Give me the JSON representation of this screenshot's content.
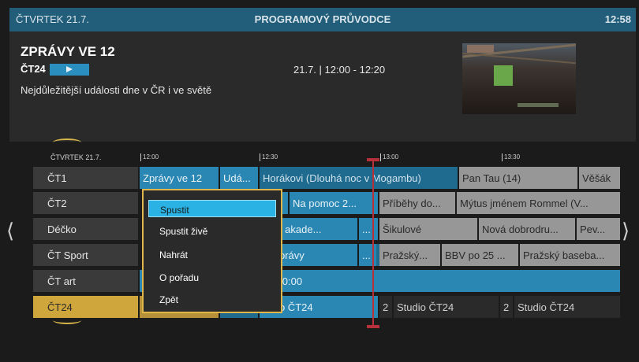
{
  "colors": {
    "accent": "#29b2e3",
    "selection": "#cfa63c",
    "now_line": "#b8303a"
  },
  "header": {
    "date": "ČTVRTEK 21.7.",
    "title": "PROGRAMOVÝ PRŮVODCE",
    "clock": "12:58"
  },
  "detail": {
    "title": "ZPRÁVY VE 12",
    "channel": "ČT24",
    "play_icon": "play-icon",
    "description": "Nejdůležitější události dne v ČR i ve světě",
    "time": "21.7.  |  12:00 - 12:20"
  },
  "grid": {
    "date": "ČTVRTEK 21.7.",
    "times": [
      "12:00",
      "12:30",
      "13:00",
      "13:30"
    ],
    "channels": [
      "ČT1",
      "ČT2",
      "Déčko",
      "ČT Sport",
      "ČT art",
      "ČT24"
    ],
    "programs": {
      "ct1": [
        "Zprávy ve 12",
        "Udá...",
        "Horákovi (Dlouhá noc v Mogambu)",
        "Pan Tau (14)",
        "Věšák"
      ],
      "ct2": [
        "r...",
        "Na pomoc 2...",
        "Příběhy do...",
        "Mýtus jménem Rommel (V..."
      ],
      "decko": [
        "eční akade...",
        "...",
        "Šikulové",
        "Nová dobrodru...",
        "Pev..."
      ],
      "ctsport": [
        "ní zprávy",
        "...",
        "...",
        "Pražský...",
        "BBV po 25 ...",
        "Pražský baseba..."
      ],
      "ctart": [
        "3-20:00"
      ],
      "ct24": [
        "tudio ČT24",
        "2",
        "Studio ČT24",
        "2",
        "Studio ČT24"
      ]
    }
  },
  "menu": {
    "items": [
      "Spustit",
      "Spustit živě",
      "Nahrát",
      "O pořadu",
      "Zpět"
    ],
    "selected": "Spustit"
  },
  "nav": {
    "left": "⟨",
    "right": "⟩"
  }
}
